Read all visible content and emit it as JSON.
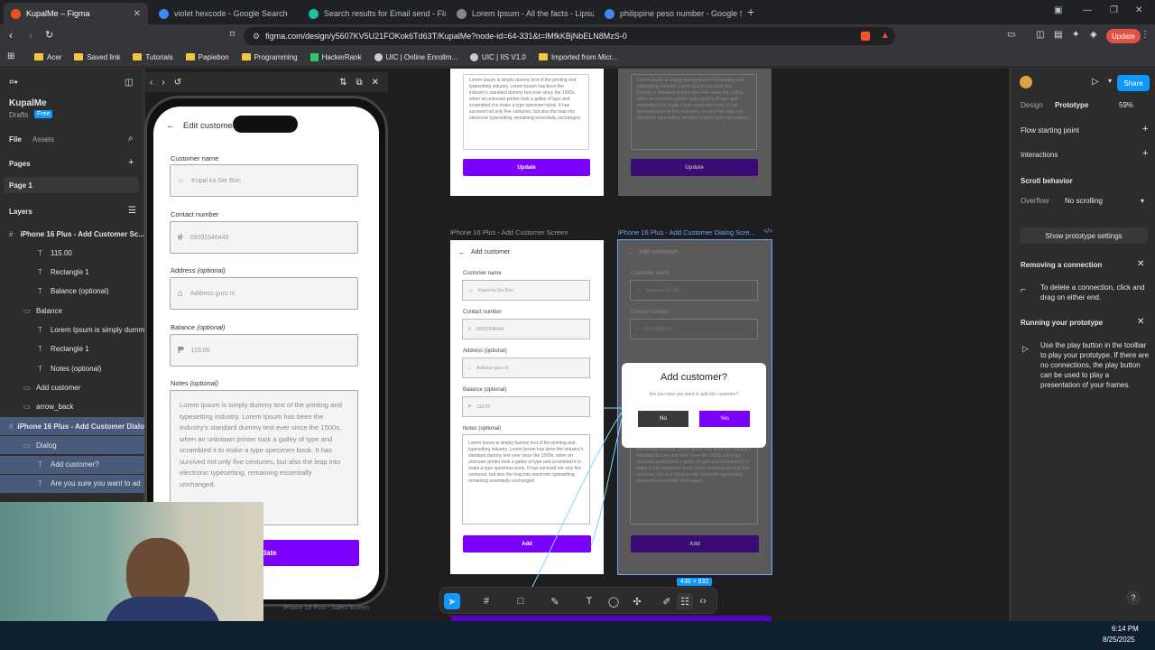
{
  "browser": {
    "tabs": [
      {
        "title": "KupalMe – Figma",
        "favicon_color": "#f24e1e"
      },
      {
        "title": "violet hexcode - Google Search",
        "favicon_color": "#4285f4"
      },
      {
        "title": "Search results for Email send - Flatic",
        "favicon_color": "#1cc29f"
      },
      {
        "title": "Lorem Ipsum - All the facts - Lipsum",
        "favicon_color": "#888888"
      },
      {
        "title": "philippine peso number - Google Se",
        "favicon_color": "#4285f4"
      }
    ],
    "url": "figma.com/design/y5607KV5U21FOKok6Td63T/KupalMe?node-id=64-331&t=lMfkKBjNbELN8MzS-0",
    "update_label": "Update",
    "bookmarks": [
      "Acer",
      "Saved link",
      "Tutorials",
      "Papiebon",
      "Programming",
      "HackerRank",
      "UIC | Online Enrollm...",
      "UIC | IIS V1.0",
      "Imported from Micr..."
    ]
  },
  "figma": {
    "file_name": "KupalMe",
    "drafts": "Drafts",
    "plan": "Free",
    "tabs": {
      "file": "File",
      "assets": "Assets"
    },
    "pages_label": "Pages",
    "page1": "Page 1",
    "layers_label": "Layers",
    "layers": [
      {
        "label": "iPhone 16 Plus - Add Customer Sc...",
        "indent": 0,
        "selected": false
      },
      {
        "label": "115.00",
        "indent": 2,
        "selected": false
      },
      {
        "label": "Rectangle 1",
        "indent": 2,
        "selected": false
      },
      {
        "label": "Balance (optional)",
        "indent": 2,
        "selected": false
      },
      {
        "label": "Balance",
        "indent": 1,
        "selected": false
      },
      {
        "label": "Lorem Ipsum is simply dumm",
        "indent": 2,
        "selected": false
      },
      {
        "label": "Rectangle 1",
        "indent": 2,
        "selected": false
      },
      {
        "label": "Notes (optional)",
        "indent": 2,
        "selected": false
      },
      {
        "label": "Add customer",
        "indent": 1,
        "selected": false
      },
      {
        "label": "arrow_back",
        "indent": 1,
        "selected": false
      },
      {
        "label": "iPhone 16 Plus - Add Customer Dialo",
        "indent": 0,
        "selected": true
      },
      {
        "label": "Dialog",
        "indent": 1,
        "selected": true
      },
      {
        "label": "Add customer?",
        "indent": 2,
        "selected": true
      },
      {
        "label": "Are you sure you want to ad",
        "indent": 2,
        "selected": true
      }
    ],
    "right": {
      "tab_design": "Design",
      "tab_prototype": "Prototype",
      "zoom": "59%",
      "share": "Share",
      "flow_starting_point": "Flow starting point",
      "interactions": "Interactions",
      "scroll_behavior": "Scroll behavior",
      "overflow_label": "Overflow",
      "overflow_value": "No scrolling",
      "show_proto_settings": "Show prototype settings",
      "removing_title": "Removing a connection",
      "removing_text": "To delete a connection, click and drag on either end.",
      "running_title": "Running your prototype",
      "running_text": "Use the play button in the toolbar to play your prototype. If there are no connections, the play button can be used to play a presentation of your frames."
    },
    "phone": {
      "title": "Edit customer",
      "customer_name_label": "Customer name",
      "customer_name_value": "Kupal ka Ser Bon",
      "contact_label": "Contact number",
      "contact_value": "09091548445",
      "address_label": "Address",
      "address_optional": "(optional)",
      "address_value": "Address guro ni",
      "balance_label": "Balance",
      "balance_optional": "(optional)",
      "balance_value": "115.00",
      "notes_label": "Notes",
      "notes_optional": "(optional)",
      "notes_value": "Lorem Ipsum is simply dummy text of the printing and typesetting industry. Lorem Ipsum has been the industry's standard dummy text ever since the 1500s, when an unknown printer took a galley of type and scrambled it to make a type specimen book. It has survived not only five centuries, but also the leap into electronic typesetting, remaining essentially unchanged.",
      "update_button": "Update"
    },
    "frames": {
      "update_label": "Update",
      "add_customer_frame_label": "iPhone 16 Plus - Add Customer Screen",
      "dialog_frame_label": "iPhone 16 Plus - Add Customer Dialog Scre...",
      "add_customer_title": "Add customer",
      "customer_name_label": "Customer name",
      "customer_name_value": "Kupal ka Ser Bon",
      "contact_label": "Contact number",
      "contact_value": "09091548445",
      "address_label": "Address (optional)",
      "address_value": "Address guro ni",
      "balance_label": "Balance (optional)",
      "balance_value": "115.00",
      "notes_label": "Notes (optional)",
      "notes_value": "Lorem Ipsum is simply dummy text of the printing and typesetting industry. Lorem Ipsum has been the industry's standard dummy text ever since the 1500s, when an unknown printer took a galley of type and scrambled it to make a type specimen book. It has survived not only five centuries, but also the leap into electronic typesetting, remaining essentially unchanged.",
      "add_button": "Add",
      "dialog_title": "Add customer?",
      "dialog_text": "Are you sure you want to add this customer?",
      "dialog_no": "No",
      "dialog_yes": "Yes",
      "size_badge": "430 × 932",
      "sales_label": "iPhone 16 Plus - Sales Screen"
    }
  },
  "taskbar": {
    "time": "6:14 PM",
    "date": "8/25/2025"
  },
  "colors": {
    "accent": "#7b00ff",
    "figma_blue": "#0d99ff"
  }
}
